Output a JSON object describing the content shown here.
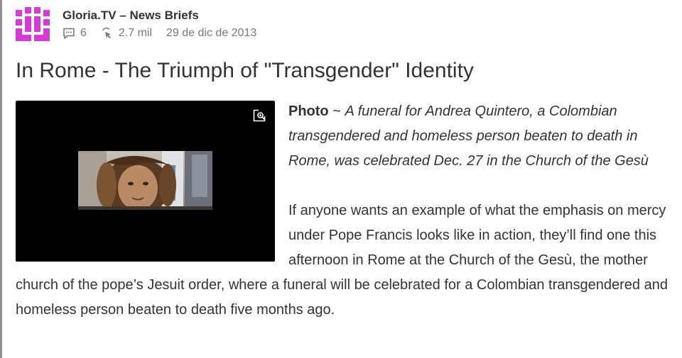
{
  "header": {
    "channel": "Gloria.TV – News Briefs",
    "comments": "6",
    "views": "2.7 mil",
    "date": "29 de dic de 2013",
    "logo_color": "#d63ad6"
  },
  "post": {
    "title": "In Rome - The Triumph of \"Transgender\" Identity",
    "lead_label": "Photo",
    "lead_sep": " ~ ",
    "caption": "A funeral for Andrea Quintero, a Colombian transgendered and homeless person beaten to death in Rome, was celebrated Dec. 27 in the Church of the Gesù",
    "body": "If anyone wants an example of what the emphasis on mercy under Pope Francis looks like in action, they’ll find one this afternoon in Rome at the Church of the Gesù, the mother church of the pope’s Jesuit order, where a funeral will be celebrated for a Colombian transgendered and homeless person beaten to death five months ago."
  },
  "icons": [
    "comment-icon",
    "views-icon",
    "zoom-icon"
  ]
}
